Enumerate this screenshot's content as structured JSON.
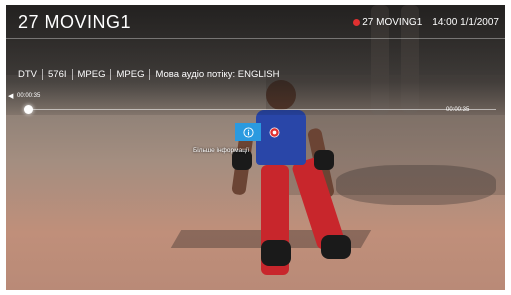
{
  "header": {
    "channel_title": "27  MOVING1",
    "recording_channel": "27 MOVING1",
    "clock": "14:00 1/1/2007"
  },
  "info_row": [
    "DTV",
    "576I",
    "MPEG",
    "MPEG",
    "Мова аудіо потіку: ENGLISH"
  ],
  "playback": {
    "start_time": "00:00:35",
    "end_time": "00:00:35",
    "progress": 0
  },
  "controls": {
    "info_icon": "info-circle-icon",
    "record_icon": "record-icon",
    "tooltip": "Більше інформації"
  },
  "colors": {
    "accent": "#2a9ae0",
    "record": "#e03030"
  }
}
